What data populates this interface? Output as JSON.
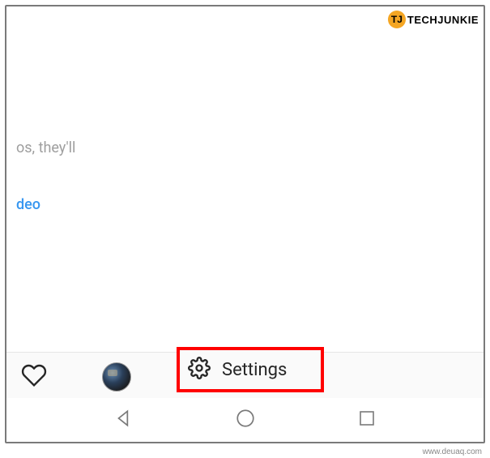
{
  "watermark": {
    "logo_initials": "TJ",
    "logo_text": "TECHJUNKIE"
  },
  "source_url": "www.deuaq.com",
  "fragments": {
    "cropped_text_1": "os, they'll",
    "cropped_text_2": "deo"
  },
  "bottom_bar": {
    "heart_icon": "heart",
    "avatar": "user-avatar"
  },
  "settings": {
    "icon": "gear",
    "label": "Settings"
  },
  "android_nav": {
    "back": "back",
    "home": "home",
    "recent": "recent"
  }
}
